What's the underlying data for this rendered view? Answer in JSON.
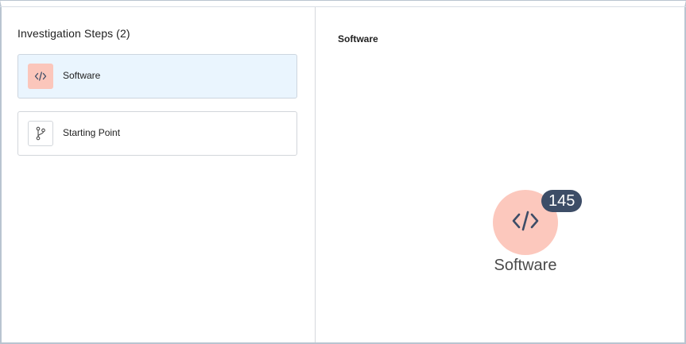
{
  "steps_panel": {
    "title": "Investigation Steps (2)",
    "steps": [
      {
        "label": "Software",
        "icon": "code-icon",
        "active": true
      },
      {
        "label": "Starting Point",
        "icon": "branch-icon",
        "active": false
      }
    ]
  },
  "detail_panel": {
    "title": "Software",
    "node": {
      "label": "Software",
      "icon": "code-icon",
      "count": "145"
    }
  },
  "colors": {
    "active_step_bg": "#eaf5fe",
    "software_accent": "#fcc8bd",
    "badge_bg": "#3d4d67",
    "code_icon_color": "#3d4d67"
  }
}
